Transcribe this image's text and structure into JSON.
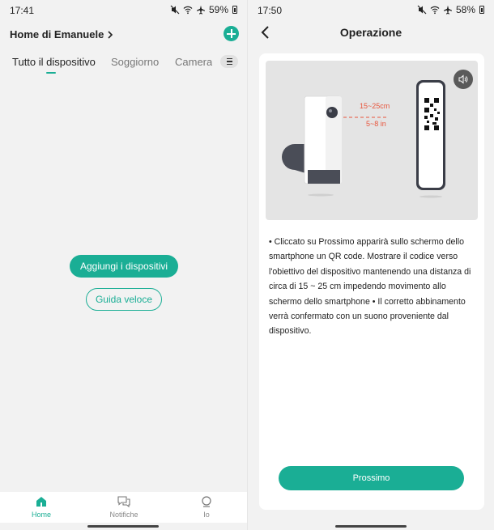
{
  "left": {
    "status": {
      "time": "17:41",
      "battery": "59%"
    },
    "header": {
      "home_name": "Home di Emanuele"
    },
    "tabs": [
      "Tutto il dispositivo",
      "Soggiorno",
      "Camera da letto"
    ],
    "buttons": {
      "add_devices": "Aggiungi i dispositivi",
      "quick_guide": "Guida veloce"
    },
    "bottom_nav": [
      {
        "label": "Home",
        "icon": "home-icon",
        "active": true
      },
      {
        "label": "Notifiche",
        "icon": "chat-icon",
        "active": false
      },
      {
        "label": "Io",
        "icon": "profile-icon",
        "active": false
      }
    ]
  },
  "right": {
    "status": {
      "time": "17:50",
      "battery": "58%"
    },
    "title": "Operazione",
    "illustration": {
      "distance_cm": "15~25cm",
      "distance_in": "5~8 in"
    },
    "instructions": "• Cliccato su Prossimo apparirà sullo schermo dello smartphone un QR code. Mostrare il codice verso l'obiettivo del dispositivo mantenendo una distanza di circa di 15 ~ 25 cm impedendo movimento allo schermo dello smartphone • Il corretto abbinamento verrà confermato con un suono proveniente dal dispositivo.",
    "next_button": "Prossimo"
  },
  "colors": {
    "accent": "#1aae95",
    "distance_label": "#e8553c"
  }
}
